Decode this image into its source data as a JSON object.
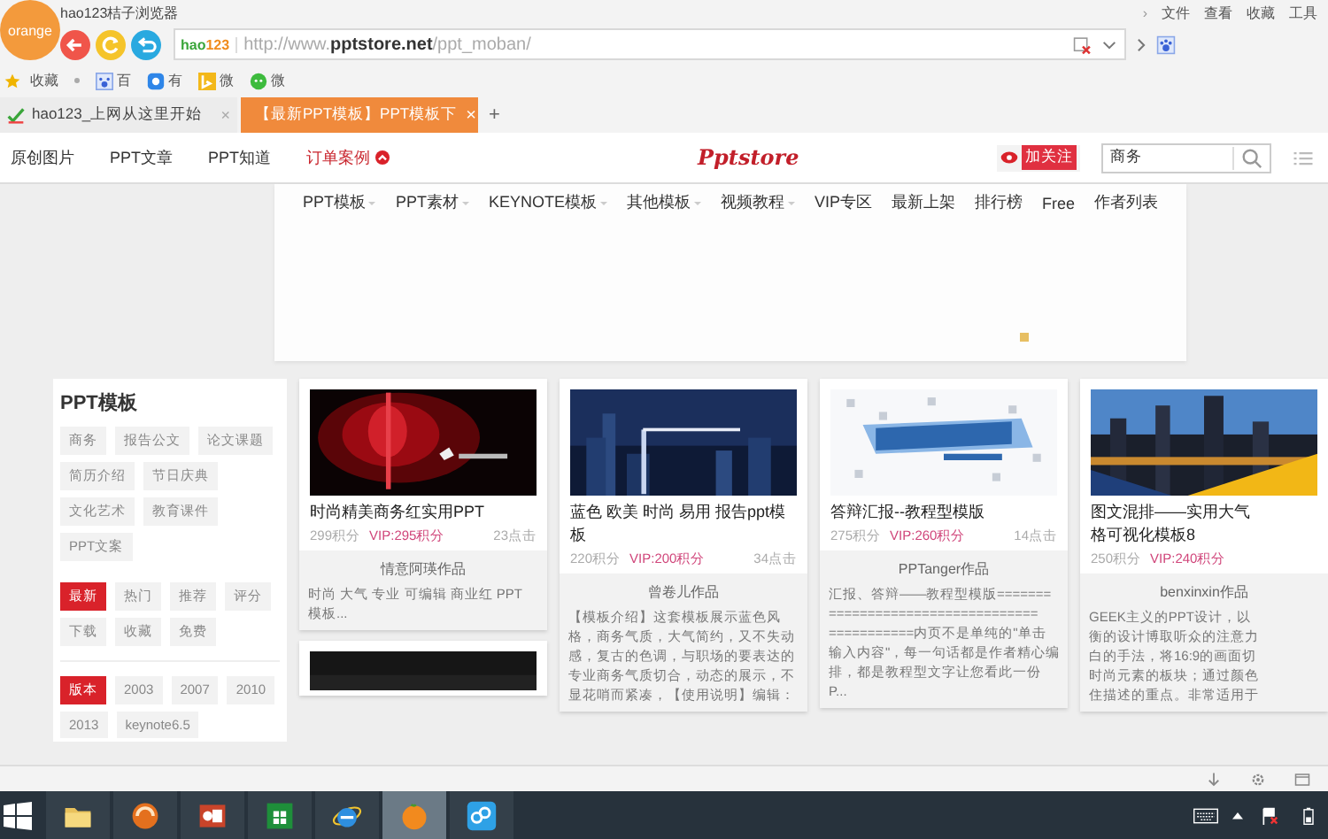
{
  "browser": {
    "logo": "orange",
    "title": "hao123桔子浏览器",
    "menu_arrow": "›",
    "menu": [
      "文件",
      "查看",
      "收藏",
      "工具"
    ],
    "address": {
      "logo_a": "hao",
      "logo_b": "123",
      "url": "http://www.**pptstore.net**/ppt_moban/"
    },
    "bookmarks": {
      "label": "收藏",
      "items": [
        {
          "label": "百"
        },
        {
          "label": "有"
        },
        {
          "label": "微"
        },
        {
          "label": "微"
        }
      ]
    },
    "tabs": [
      {
        "label": "hao123_上网从这里开始",
        "close": "×",
        "selected": false
      },
      {
        "label": "【最新PPT模板】PPT模板下",
        "close": "×",
        "selected": true
      }
    ],
    "new_tab": "+"
  },
  "site": {
    "nav": [
      {
        "label": "原创图片",
        "highlight": false
      },
      {
        "label": "PPT文章",
        "highlight": false
      },
      {
        "label": "PPT知道",
        "highlight": false
      },
      {
        "label": "订单案例",
        "highlight": true
      }
    ],
    "logo": "Pptstore",
    "follow": "加关注",
    "search": {
      "value": "商务"
    },
    "menu": [
      {
        "label": "PPT模板",
        "dropdown": true
      },
      {
        "label": "PPT素材",
        "dropdown": true
      },
      {
        "label": "KEYNOTE模板",
        "dropdown": true
      },
      {
        "label": "其他模板",
        "dropdown": true
      },
      {
        "label": "视频教程",
        "dropdown": true
      },
      {
        "label": "VIP专区",
        "dropdown": false
      },
      {
        "label": "最新上架",
        "dropdown": false
      },
      {
        "label": "排行榜",
        "dropdown": false
      },
      {
        "label": "Free",
        "dropdown": false
      },
      {
        "label": "作者列表",
        "dropdown": false
      }
    ]
  },
  "sidebar": {
    "title": "PPT模板",
    "categories": [
      "商务",
      "报告公文",
      "论文课题",
      "简历介绍",
      "节日庆典",
      "文化艺术",
      "教育课件",
      "PPT文案"
    ],
    "sorts": [
      {
        "label": "最新",
        "selected": true
      },
      {
        "label": "热门",
        "selected": false
      },
      {
        "label": "推荐",
        "selected": false
      },
      {
        "label": "评分",
        "selected": false
      },
      {
        "label": "下载",
        "selected": false
      },
      {
        "label": "收藏",
        "selected": false
      },
      {
        "label": "免费",
        "selected": false
      }
    ],
    "versions": [
      {
        "label": "版本",
        "selected": true
      },
      {
        "label": "2003",
        "selected": false
      },
      {
        "label": "2007",
        "selected": false
      },
      {
        "label": "2010",
        "selected": false
      },
      {
        "label": "2013",
        "selected": false
      },
      {
        "label": "keynote6.5",
        "selected": false
      }
    ]
  },
  "columns": [
    [
      {
        "title": [
          "时尚精美商务红实用PPT"
        ],
        "points": "299积分",
        "vip": "VIP:295积分",
        "clicks": "23点击",
        "author": "情意阿瑛作品",
        "desc": [
          "时尚 大气 专业 可编辑 商业红 PPT",
          "模板..."
        ]
      },
      {
        "kind": "picture"
      }
    ],
    [
      {
        "title": [
          "蓝色 欧美 时尚 易用 报告ppt模",
          "板"
        ],
        "points": "220积分",
        "vip": "VIP:200积分",
        "clicks": "34点击",
        "author": "曾卷儿作品",
        "desc": [
          "【模板介绍】这套模板展示蓝色风",
          "格，商务气质，大气简约，又不失动",
          "感，复古的色调，与职场的要表达的",
          "专业商务气质切合，动态的展示，不",
          "显花哨而紧凑，【使用说明】编辑："
        ]
      }
    ],
    [
      {
        "title": [
          "答辩汇报--教程型模版"
        ],
        "points": "275积分",
        "vip": "VIP:260积分",
        "clicks": "14点击",
        "author": "PPTanger作品",
        "desc": [
          "汇报、答辩——教程型模版=======",
          "===========================",
          "===========内页不是单纯的\"单击",
          "输入内容\"，每一句话都是作者精心编",
          "排，都是教程型文字让您看此一份",
          "P..."
        ]
      }
    ],
    [
      {
        "title": [
          "图文混排——实用大气",
          "格可视化模板8"
        ],
        "points": "250积分",
        "vip": "VIP:240积分",
        "author": "benxinxin作品",
        "desc": [
          "GEEK主义的PPT设计，以",
          "衡的设计博取听众的注意力",
          "白的手法，将16:9的画面切",
          "时尚元素的板块；通过颜色",
          "住描述的重点。非常适用于"
        ]
      }
    ]
  ],
  "taskbar": {
    "apps": [
      {
        "selected": false
      },
      {
        "selected": false
      },
      {
        "selected": false
      },
      {
        "selected": false
      },
      {
        "selected": false
      },
      {
        "selected": true
      },
      {
        "selected": false
      }
    ]
  }
}
